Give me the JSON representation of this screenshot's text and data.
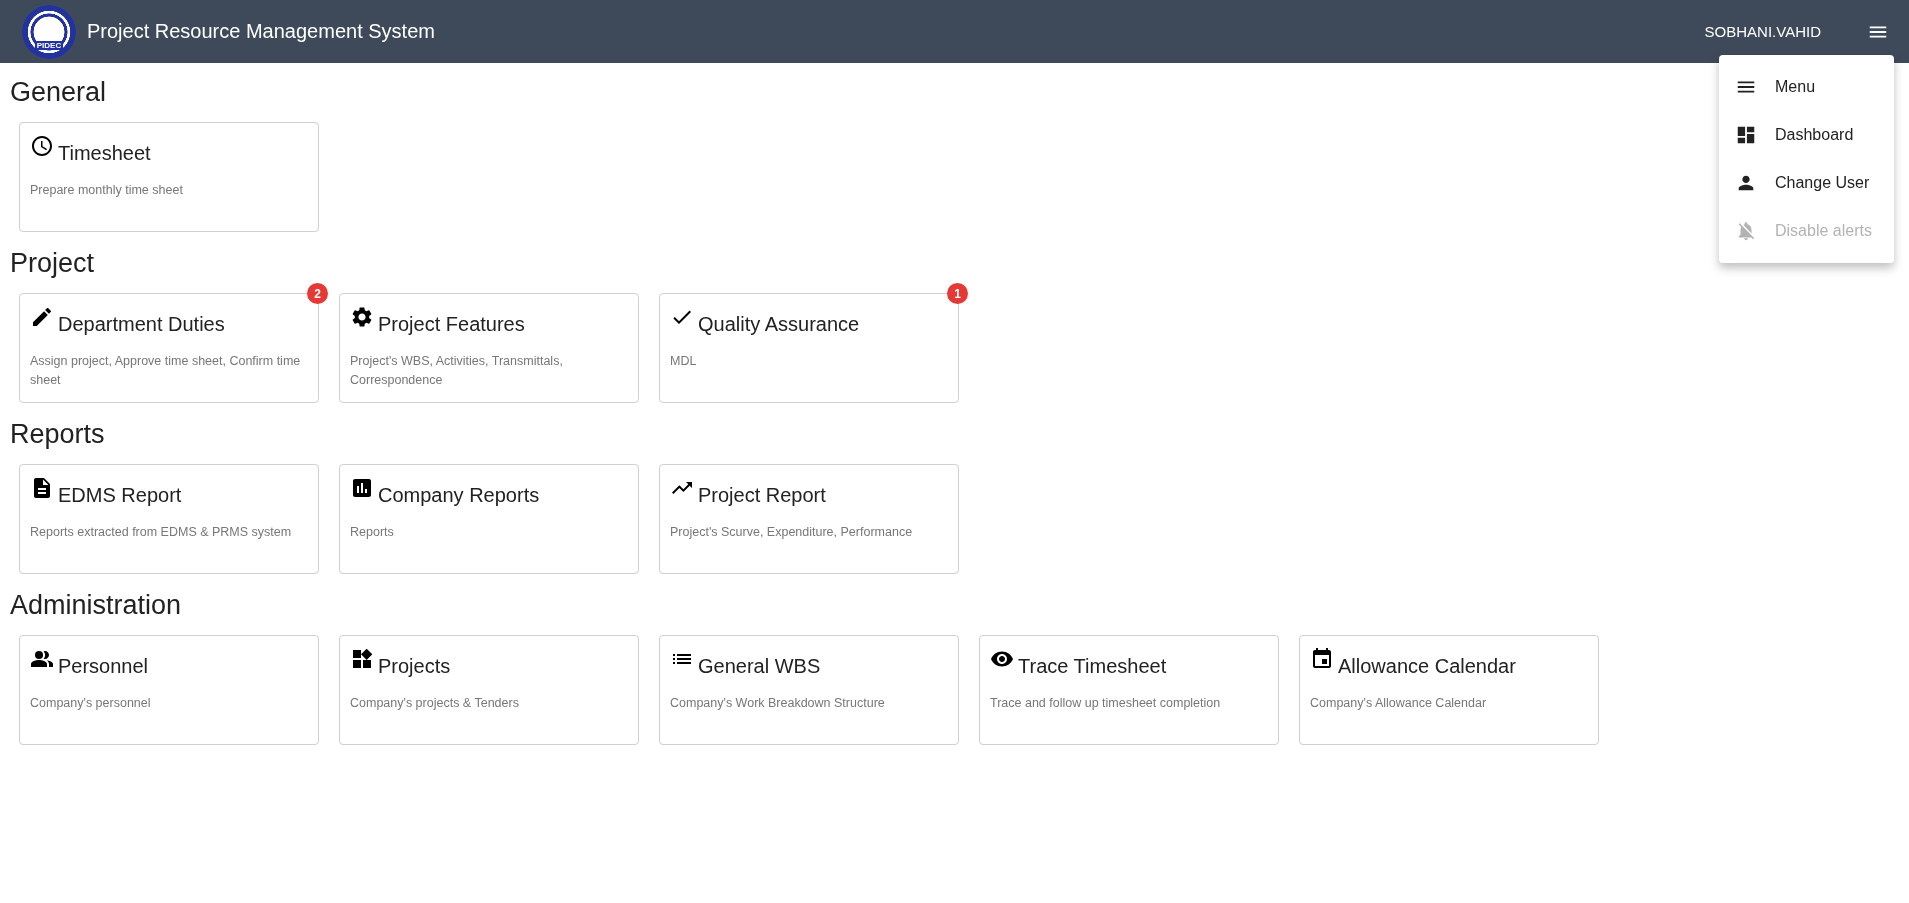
{
  "header": {
    "logo_text": "PIDEC",
    "title": "Project Resource Management System",
    "user": "SOBHANI.VAHID"
  },
  "menu": {
    "items": [
      {
        "label": "Menu",
        "kind": "menu",
        "disabled": false
      },
      {
        "label": "Dashboard",
        "kind": "dashboard",
        "disabled": false
      },
      {
        "label": "Change User",
        "kind": "user",
        "disabled": false
      },
      {
        "label": "Disable alerts",
        "kind": "alerts-off",
        "disabled": true
      }
    ]
  },
  "sections": [
    {
      "title": "General",
      "cards": [
        {
          "kind": "clock",
          "title": "Timesheet",
          "description": "Prepare monthly time sheet"
        }
      ]
    },
    {
      "title": "Project",
      "cards": [
        {
          "kind": "edit",
          "title": "Department Duties",
          "description": "Assign project, Approve time sheet, Confirm time sheet",
          "badge": "2"
        },
        {
          "kind": "gear",
          "title": "Project Features",
          "description": "Project's WBS, Activities, Transmittals, Correspondence"
        },
        {
          "kind": "check",
          "title": "Quality Assurance",
          "description": "MDL",
          "badge": "1"
        }
      ]
    },
    {
      "title": "Reports",
      "cards": [
        {
          "kind": "document",
          "title": "EDMS Report",
          "description": "Reports extracted from EDMS & PRMS system"
        },
        {
          "kind": "chart",
          "title": "Company Reports",
          "description": "Reports"
        },
        {
          "kind": "trend",
          "title": "Project Report",
          "description": "Project's Scurve, Expenditure, Performance"
        }
      ]
    },
    {
      "title": "Administration",
      "cards": [
        {
          "kind": "people",
          "title": "Personnel",
          "description": "Company's personnel"
        },
        {
          "kind": "widgets",
          "title": "Projects",
          "description": "Company's projects & Tenders"
        },
        {
          "kind": "list",
          "title": "General WBS",
          "description": "Company's Work Breakdown Structure"
        },
        {
          "kind": "eye",
          "title": "Trace Timesheet",
          "description": "Trace and follow up timesheet completion"
        },
        {
          "kind": "calendar",
          "title": "Allowance Calendar",
          "description": "Company's Allowance Calendar"
        }
      ]
    }
  ]
}
